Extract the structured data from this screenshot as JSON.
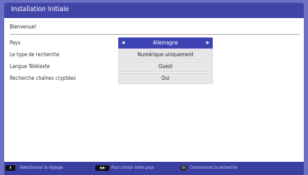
{
  "window": {
    "title": "Installation Initiale"
  },
  "welcome": "Bienvenue!",
  "settings": [
    {
      "label": "Pays",
      "value": "Allemagne",
      "selected": true
    },
    {
      "label": "Le type de recherche",
      "value": "Numérique uniquement",
      "selected": false
    },
    {
      "label": "Langue Télétexte",
      "value": "Ouest",
      "selected": false
    },
    {
      "label": "Recherche chaînes cryptées",
      "value": "Oui",
      "selected": false
    }
  ],
  "icons": {
    "left_arrow": "◀",
    "right_arrow": "▶",
    "updown_key": "⬍",
    "leftright_key": "◀ ▶",
    "ok_key": "OK"
  },
  "footer": {
    "hints": [
      {
        "text": "Sélectionner le réglage"
      },
      {
        "text": "Pour choisir votre pays"
      },
      {
        "text": "Commencez la recherche"
      }
    ]
  },
  "colors": {
    "background": "#6c70c4",
    "title_bar": "#4145a8",
    "selected_row": "#3e43b4",
    "footer_bar": "#3b3f9f"
  }
}
